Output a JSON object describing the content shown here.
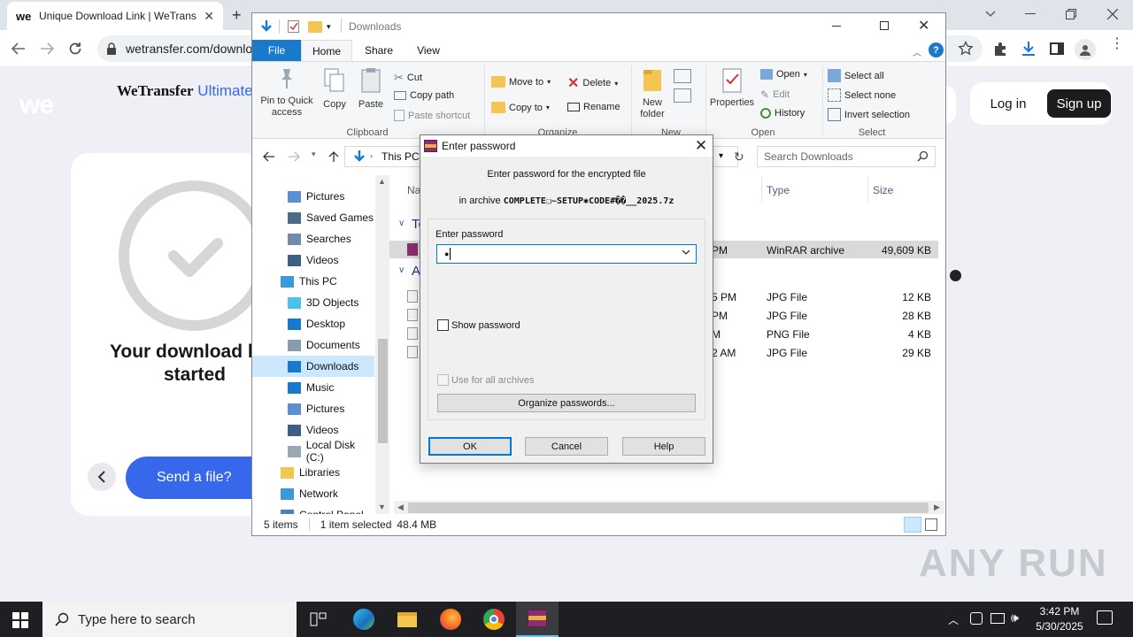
{
  "chrome": {
    "tab_title": "Unique Download Link | WeTransfer",
    "url": "wetransfer.com/downloads",
    "new_tab_symbol": "+",
    "icons": [
      "wetransfer-favicon",
      "close-icon",
      "new-tab-icon",
      "chevron-down-icon",
      "minimize-icon",
      "restore-icon",
      "close-window-icon",
      "back-icon",
      "forward-icon",
      "reload-icon",
      "site-info-icon",
      "bookmark-star-icon",
      "extensions-icon",
      "download-icon",
      "side-panel-icon",
      "profile-icon",
      "menu-icon"
    ]
  },
  "wetransfer": {
    "logo_text": "WeTransfer",
    "logo_suffix": "Ultimate",
    "we_mark": "we",
    "login": "Log in",
    "signup": "Sign up",
    "download_title": "Your download has started",
    "send_button": "Send a file?"
  },
  "explorer": {
    "title": "Downloads",
    "tabs": [
      "File",
      "Home",
      "Share",
      "View"
    ],
    "ribbon": {
      "clipboard": {
        "pin": "Pin to Quick access",
        "copy": "Copy",
        "paste": "Paste",
        "cut": "Cut",
        "copy_path": "Copy path",
        "paste_shortcut": "Paste shortcut",
        "group": "Clipboard"
      },
      "organize": {
        "move_to": "Move to",
        "copy_to": "Copy to",
        "delete": "Delete",
        "rename": "Rename",
        "group": "Organize"
      },
      "new": {
        "new_folder": "New folder",
        "group": "New"
      },
      "open": {
        "properties": "Properties",
        "open": "Open",
        "edit": "Edit",
        "history": "History",
        "group": "Open"
      },
      "select": {
        "select_all": "Select all",
        "select_none": "Select none",
        "invert": "Invert selection",
        "group": "Select"
      }
    },
    "address": {
      "path": "This PC",
      "search_placeholder": "Search Downloads"
    },
    "nav": [
      {
        "label": "Pictures",
        "icon": "pictures-icon",
        "indent": 1
      },
      {
        "label": "Saved Games",
        "icon": "saved-games-icon",
        "indent": 1
      },
      {
        "label": "Searches",
        "icon": "search-folder-icon",
        "indent": 1
      },
      {
        "label": "Videos",
        "icon": "videos-icon",
        "indent": 1
      },
      {
        "label": "This PC",
        "icon": "this-pc-icon",
        "indent": 0
      },
      {
        "label": "3D Objects",
        "icon": "3d-objects-icon",
        "indent": 1
      },
      {
        "label": "Desktop",
        "icon": "desktop-icon",
        "indent": 1
      },
      {
        "label": "Documents",
        "icon": "documents-icon",
        "indent": 1
      },
      {
        "label": "Downloads",
        "icon": "downloads-icon",
        "indent": 1,
        "selected": true
      },
      {
        "label": "Music",
        "icon": "music-icon",
        "indent": 1
      },
      {
        "label": "Pictures",
        "icon": "pictures-icon",
        "indent": 1
      },
      {
        "label": "Videos",
        "icon": "videos-icon",
        "indent": 1
      },
      {
        "label": "Local Disk (C:)",
        "icon": "disk-icon",
        "indent": 1
      },
      {
        "label": "Libraries",
        "icon": "libraries-icon",
        "indent": 0
      },
      {
        "label": "Network",
        "icon": "network-icon",
        "indent": 0
      },
      {
        "label": "Control Panel",
        "icon": "control-panel-icon",
        "indent": 0
      }
    ],
    "columns": {
      "name": "Na",
      "type": "Type",
      "size": "Size"
    },
    "groups": [
      "To",
      "A"
    ],
    "files": [
      {
        "date": "PM",
        "type": "WinRAR archive",
        "size": "49,609 KB",
        "selected": true
      },
      {
        "date": "5 PM",
        "type": "JPG File",
        "size": "12 KB"
      },
      {
        "date": "PM",
        "type": "JPG File",
        "size": "28 KB"
      },
      {
        "date": "M",
        "type": "PNG File",
        "size": "4 KB"
      },
      {
        "date": "2 AM",
        "type": "JPG File",
        "size": "29 KB"
      }
    ],
    "status": {
      "items": "5 items",
      "selected": "1 item selected",
      "size": "48.4 MB"
    }
  },
  "dialog": {
    "title": "Enter password",
    "line1": "Enter password for the encrypted file",
    "line2_prefix": "in archive",
    "archive_name": "COMPLETE❏~SETUP✱CODE#��__2025.7z",
    "pw_label": "Enter password",
    "pw_value": "●",
    "show_password": "Show password",
    "use_all": "Use for all archives",
    "organize": "Organize passwords...",
    "ok": "OK",
    "cancel": "Cancel",
    "help": "Help"
  },
  "taskbar": {
    "search_placeholder": "Type here to search",
    "time": "3:42 PM",
    "date": "5/30/2025"
  },
  "watermark": "ANY RUN",
  "colors": {
    "accent": "#1979ca",
    "wt_blue": "#3767ea",
    "selection": "#cce8ff"
  }
}
